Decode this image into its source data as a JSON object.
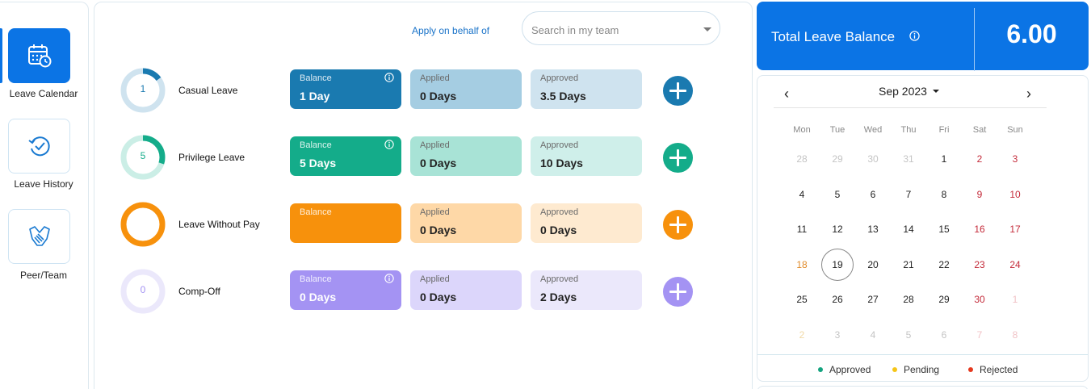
{
  "sidebar": {
    "items": [
      {
        "label": "Leave Calendar",
        "icon": "calendar-clock-icon",
        "active": true
      },
      {
        "label": "Leave History",
        "icon": "history-icon",
        "active": false
      },
      {
        "label": "Peer/Team",
        "icon": "handshake-icon",
        "active": false
      }
    ]
  },
  "header": {
    "apply_link": "Apply on behalf of",
    "search_placeholder": "Search in my team"
  },
  "leave_types": [
    {
      "name": "Casual Leave",
      "ring_value": "1",
      "ring_fraction": 0.15,
      "color": "#1a7ab0",
      "track": "#cfe3ef",
      "balance_label": "Balance",
      "balance": "1 Day",
      "applied_label": "Applied",
      "applied": "0 Days",
      "approved_label": "Approved",
      "approved": "3.5 Days",
      "applied_bg": "#a5cde2",
      "approved_bg": "#cfe3ef"
    },
    {
      "name": "Privilege Leave",
      "ring_value": "5",
      "ring_fraction": 0.3,
      "color": "#14ac8a",
      "track": "#cbeee6",
      "balance_label": "Balance",
      "balance": "5 Days",
      "applied_label": "Applied",
      "applied": "0 Days",
      "approved_label": "Approved",
      "approved": "10 Days",
      "applied_bg": "#a8e3d6",
      "approved_bg": "#cfefea"
    },
    {
      "name": "Leave Without Pay",
      "ring_value": "",
      "ring_fraction": 1.0,
      "color": "#f7910c",
      "track": "#fde2bc",
      "balance_label": "Balance",
      "balance": "",
      "applied_label": "Applied",
      "applied": "0 Days",
      "approved_label": "Approved",
      "approved": "0 Days",
      "applied_bg": "#fed8a7",
      "approved_bg": "#feead0"
    },
    {
      "name": "Comp-Off",
      "ring_value": "0",
      "ring_fraction": 0.0,
      "color": "#a493f3",
      "track": "#ebe8fb",
      "balance_label": "Balance",
      "balance": "0 Days",
      "applied_label": "Applied",
      "applied": "0 Days",
      "approved_label": "Approved",
      "approved": "2 Days",
      "applied_bg": "#dcd6fb",
      "approved_bg": "#ebe8fb"
    }
  ],
  "total": {
    "label": "Total Leave Balance",
    "value": "6.00"
  },
  "calendar": {
    "month": "Sep 2023",
    "weekdays": [
      "Mon",
      "Tue",
      "Wed",
      "Thu",
      "Fri",
      "Sat",
      "Sun"
    ],
    "weeks": [
      [
        {
          "d": "28",
          "m": 1
        },
        {
          "d": "29",
          "m": 1
        },
        {
          "d": "30",
          "m": 1
        },
        {
          "d": "31",
          "m": 1
        },
        {
          "d": "1"
        },
        {
          "d": "2",
          "w": 1
        },
        {
          "d": "3",
          "w": 1
        }
      ],
      [
        {
          "d": "4"
        },
        {
          "d": "5"
        },
        {
          "d": "6"
        },
        {
          "d": "7"
        },
        {
          "d": "8"
        },
        {
          "d": "9",
          "w": 1
        },
        {
          "d": "10",
          "w": 1
        }
      ],
      [
        {
          "d": "11"
        },
        {
          "d": "12"
        },
        {
          "d": "13"
        },
        {
          "d": "14"
        },
        {
          "d": "15"
        },
        {
          "d": "16",
          "w": 1
        },
        {
          "d": "17",
          "w": 1
        }
      ],
      [
        {
          "d": "18",
          "h": 1
        },
        {
          "d": "19",
          "t": 1
        },
        {
          "d": "20"
        },
        {
          "d": "21"
        },
        {
          "d": "22"
        },
        {
          "d": "23",
          "w": 1
        },
        {
          "d": "24",
          "w": 1
        }
      ],
      [
        {
          "d": "25"
        },
        {
          "d": "26"
        },
        {
          "d": "27"
        },
        {
          "d": "28"
        },
        {
          "d": "29"
        },
        {
          "d": "30",
          "w": 1
        },
        {
          "d": "1",
          "w": 1,
          "m": 1
        }
      ],
      [
        {
          "d": "2",
          "h": 1,
          "m": 1
        },
        {
          "d": "3",
          "m": 1
        },
        {
          "d": "4",
          "m": 1
        },
        {
          "d": "5",
          "m": 1
        },
        {
          "d": "6",
          "m": 1
        },
        {
          "d": "7",
          "w": 1,
          "m": 1
        },
        {
          "d": "8",
          "w": 1,
          "m": 1
        }
      ]
    ],
    "legend": [
      {
        "label": "Approved",
        "color": "#14a37f"
      },
      {
        "label": "Pending",
        "color": "#f5c518"
      },
      {
        "label": "Rejected",
        "color": "#e5391f"
      }
    ]
  }
}
